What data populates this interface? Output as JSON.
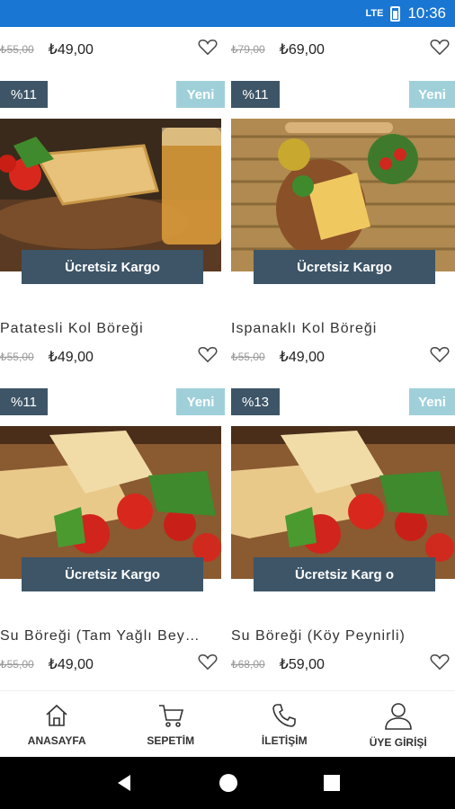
{
  "status": {
    "signal": "LTE",
    "time": "10:36"
  },
  "top_row": [
    {
      "old_price": "₺55,00",
      "price": "₺49,00"
    },
    {
      "old_price": "₺79,00",
      "price": "₺69,00"
    }
  ],
  "products": [
    {
      "discount": "%11",
      "new_label": "Yeni",
      "cargo": "Ücretsiz Kargo",
      "title": "Patatesli Kol Böreği",
      "old_price": "₺55,00",
      "price": "₺49,00"
    },
    {
      "discount": "%11",
      "new_label": "Yeni",
      "cargo": "Ücretsiz Kargo",
      "title": "Ispanaklı Kol Böreği",
      "old_price": "₺55,00",
      "price": "₺49,00"
    },
    {
      "discount": "%11",
      "new_label": "Yeni",
      "cargo": "Ücretsiz Kargo",
      "title": "Su Böreği (Tam Yağlı Bey…",
      "old_price": "₺55,00",
      "price": "₺49,00"
    },
    {
      "discount": "%13",
      "new_label": "Yeni",
      "cargo": "Ücretsiz Karg o",
      "title": "Su Böreği (Köy Peynirli)",
      "old_price": "₺68,00",
      "price": "₺59,00"
    }
  ],
  "tabs": [
    {
      "label": "ANASAYFA",
      "icon": "home-icon"
    },
    {
      "label": "SEPETİM",
      "icon": "cart-icon"
    },
    {
      "label": "İLETİŞİM",
      "icon": "phone-icon"
    },
    {
      "label": "ÜYE GİRİŞİ",
      "icon": "user-icon"
    }
  ],
  "colors": {
    "accent_dark": "#3d5567",
    "accent_light": "#9fd0da",
    "statusbar": "#1976d2"
  }
}
